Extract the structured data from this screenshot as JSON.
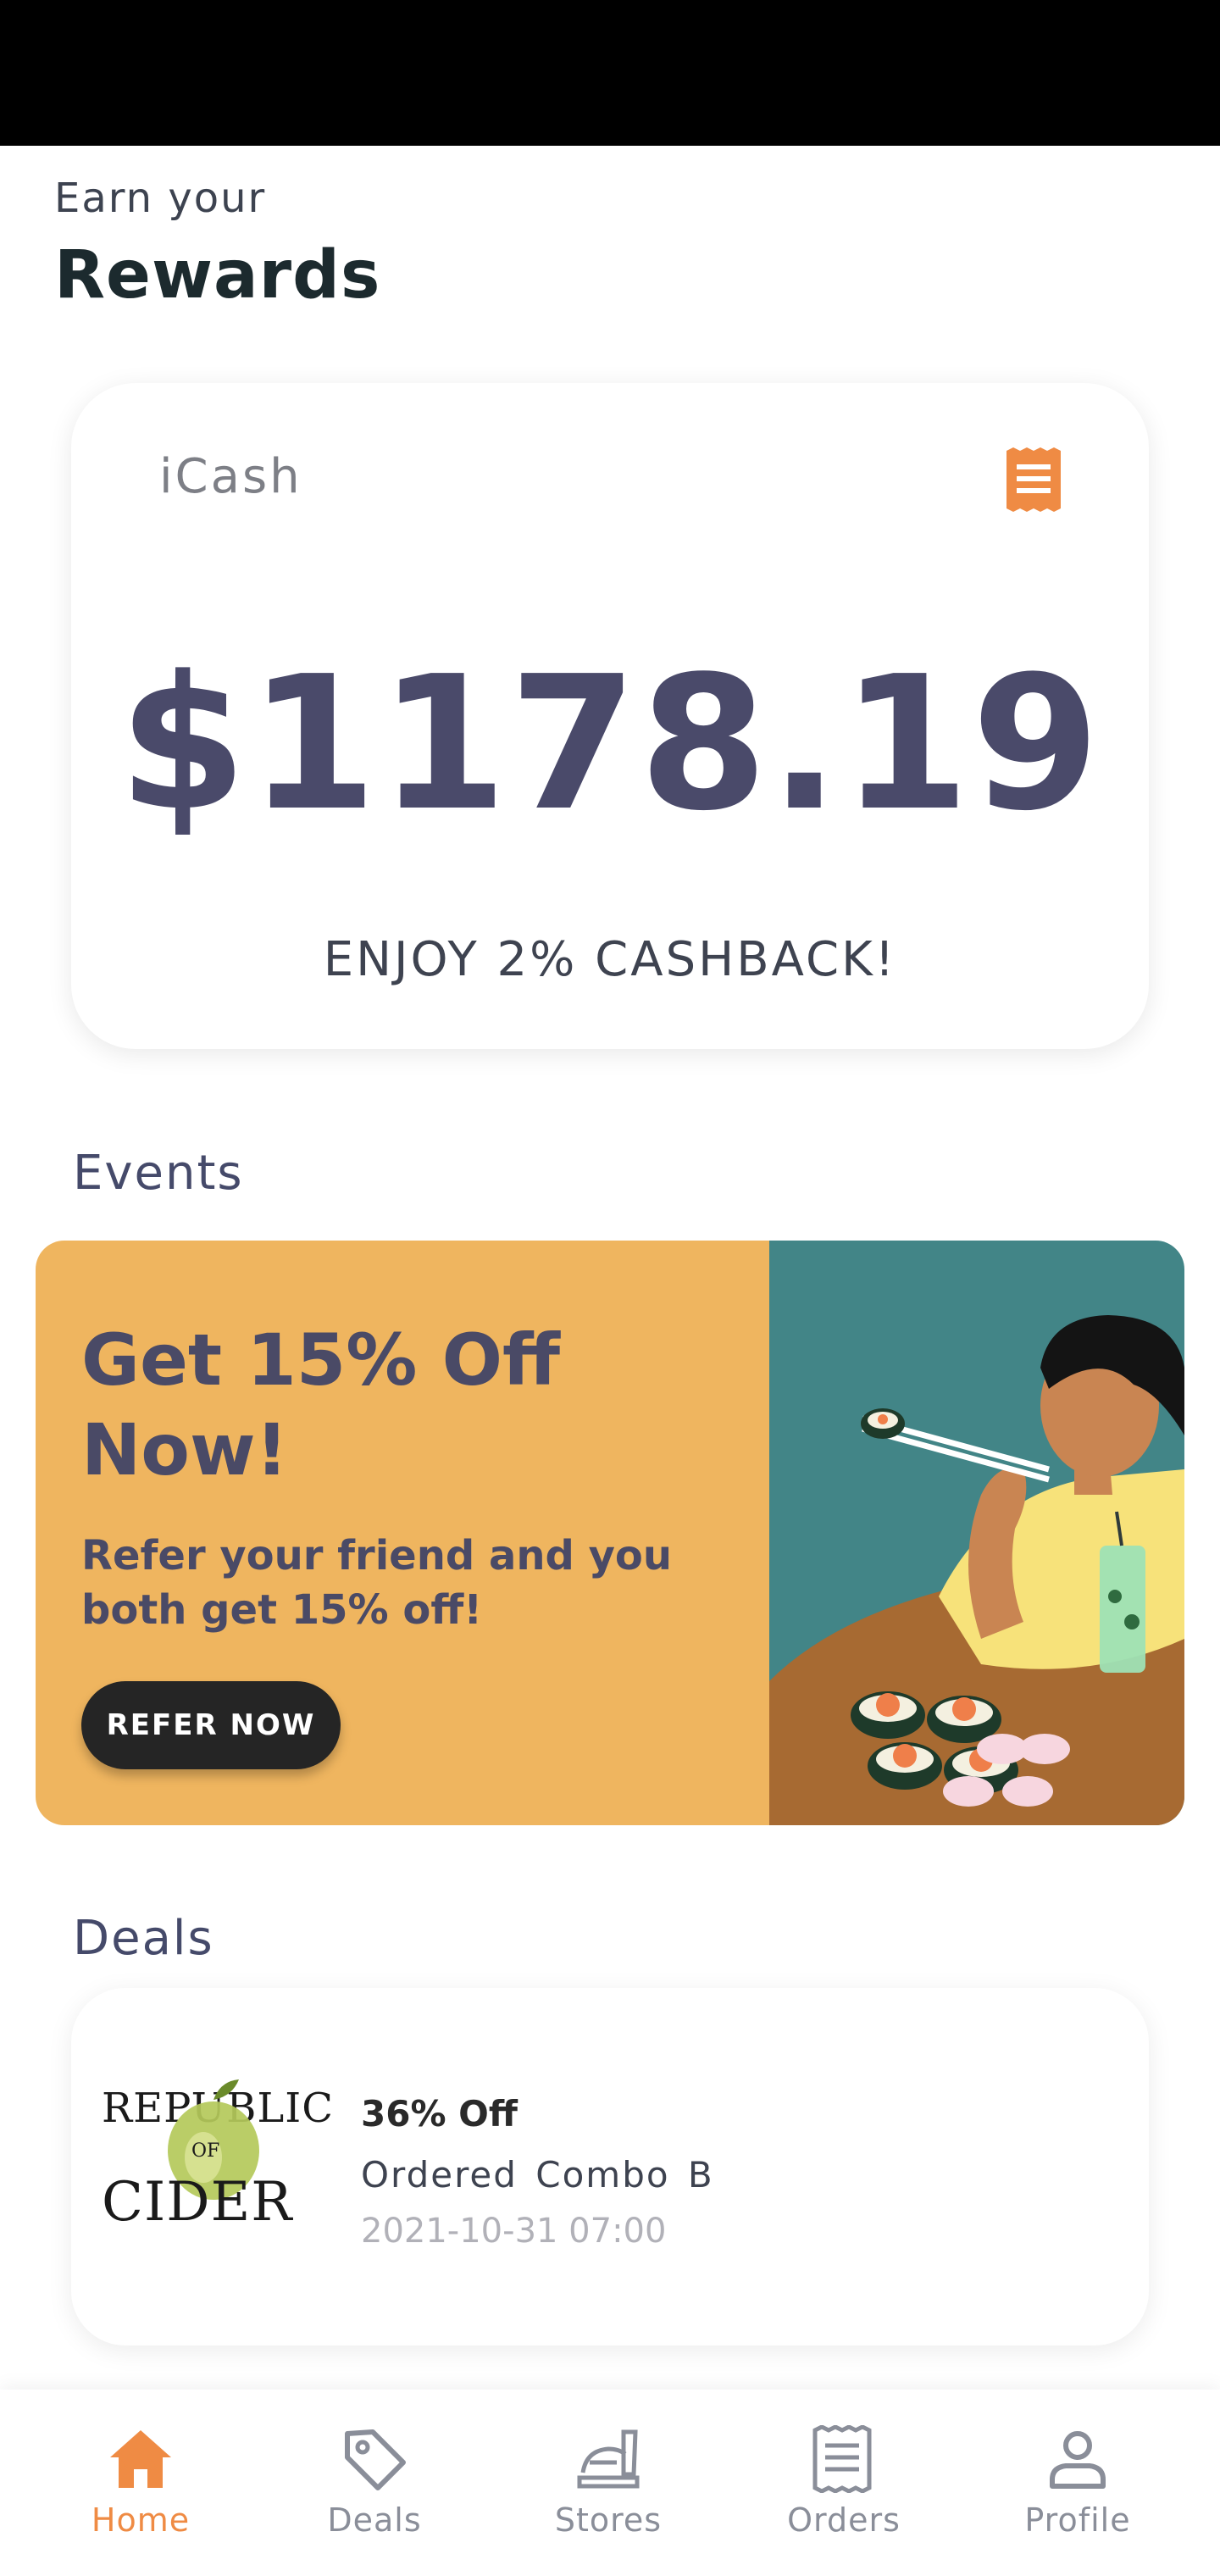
{
  "header": {
    "subtitle": "Earn your",
    "title": "Rewards"
  },
  "icash": {
    "label": "iCash",
    "amount": "$1178.19",
    "note": "ENJOY 2% CASHBACK!",
    "receipt_icon": "receipt-icon"
  },
  "events": {
    "section_title": "Events",
    "banner": {
      "title": "Get 15% Off Now!",
      "description": "Refer your friend and you both get 15% off!",
      "button_label": "REFER NOW"
    }
  },
  "deals": {
    "section_title": "Deals",
    "items": [
      {
        "logo_line1": "REPUBLIC",
        "logo_mid": "OF",
        "logo_line2": "CIDER",
        "title": "36% Off",
        "name": "Ordered Combo B",
        "date": "2021-10-31 07:00"
      }
    ]
  },
  "nav": {
    "items": [
      {
        "label": "Home",
        "icon": "home-icon",
        "active": true
      },
      {
        "label": "Deals",
        "icon": "tag-icon",
        "active": false
      },
      {
        "label": "Stores",
        "icon": "food-tray-icon",
        "active": false
      },
      {
        "label": "Orders",
        "icon": "receipt-icon",
        "active": false
      },
      {
        "label": "Profile",
        "icon": "user-icon",
        "active": false
      }
    ]
  },
  "colors": {
    "accent": "#ef8b44",
    "banner_left": "#efb55f",
    "banner_right": "#428587",
    "amount": "#4a4a6a"
  }
}
